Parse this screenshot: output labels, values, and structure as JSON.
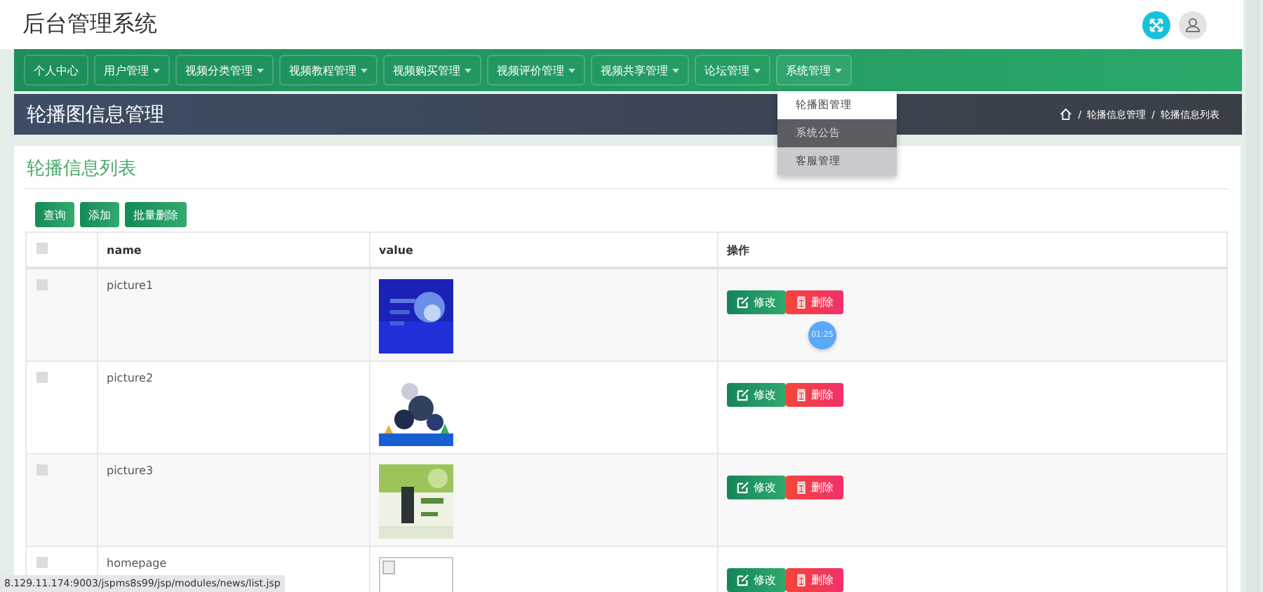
{
  "header": {
    "title": "后台管理系统"
  },
  "nav": [
    {
      "label": "个人中心",
      "selected": false
    },
    {
      "label": "用户管理",
      "selected": false
    },
    {
      "label": "视频分类管理",
      "selected": false
    },
    {
      "label": "视频教程管理",
      "selected": false
    },
    {
      "label": "视频购买管理",
      "selected": false
    },
    {
      "label": "视频评价管理",
      "selected": false
    },
    {
      "label": "视频共享管理",
      "selected": false
    },
    {
      "label": "论坛管理",
      "selected": false
    },
    {
      "label": "系统管理",
      "selected": true
    }
  ],
  "dropdown": [
    {
      "label": "轮播图管理",
      "selected": false
    },
    {
      "label": "系统公告",
      "selected": true
    },
    {
      "label": "客服管理",
      "selected": false
    }
  ],
  "page_header": {
    "title": "轮播图信息管理",
    "breadcrumb": [
      "轮播信息管理",
      "轮播信息列表"
    ],
    "breadcrumb_separator": "/"
  },
  "card": {
    "title": "轮播信息列表",
    "buttons": [
      "查询",
      "添加",
      "批量删除"
    ]
  },
  "table": {
    "all_checked": false,
    "columns": [
      "name",
      "value",
      "操作"
    ],
    "rows": [
      {
        "checked": false,
        "name": "picture1",
        "image": {
          "kind": "picture"
        },
        "actions": [
          "修改",
          "删除"
        ]
      },
      {
        "checked": false,
        "name": "picture2",
        "image": {
          "kind": "picture"
        },
        "actions": [
          "修改",
          "删除"
        ]
      },
      {
        "checked": false,
        "name": "picture3",
        "image": {
          "kind": "picture"
        },
        "actions": [
          "修改",
          "删除"
        ]
      },
      {
        "checked": false,
        "name": "homepage",
        "image": {
          "kind": "broken"
        },
        "actions": [
          "修改",
          "删除"
        ]
      }
    ]
  },
  "timer": "01:25",
  "status_bar": "8.129.11.174:9003/jspms8s99/jsp/modules/news/list.jsp"
}
